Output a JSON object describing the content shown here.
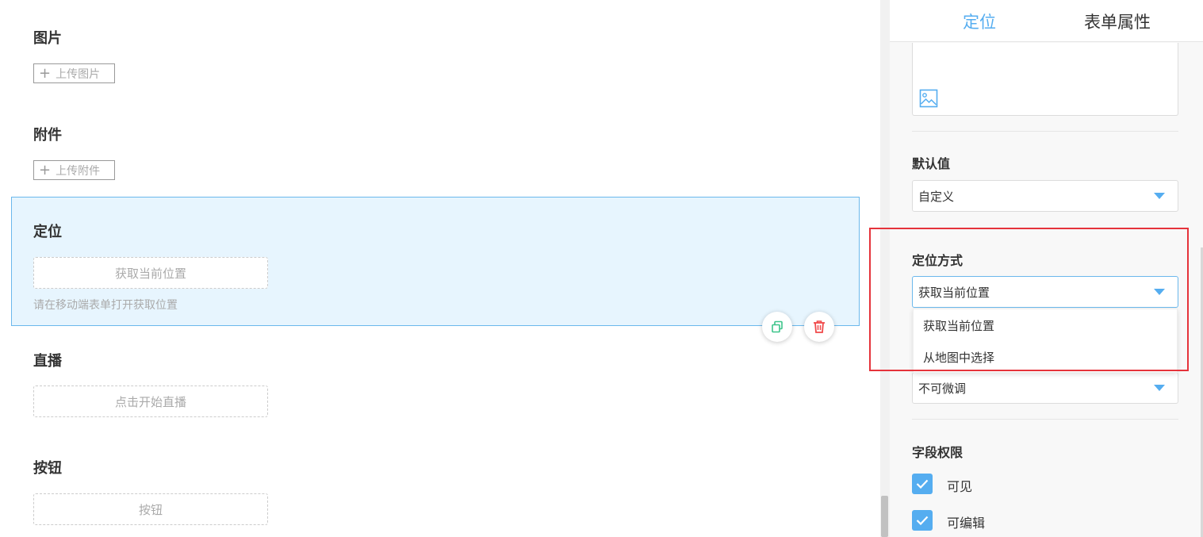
{
  "canvas": {
    "image_field": {
      "title": "图片",
      "upload_label": "上传图片"
    },
    "attachment_field": {
      "title": "附件",
      "upload_label": "上传附件"
    },
    "location_field": {
      "title": "定位",
      "button_label": "获取当前位置",
      "hint": "请在移动端表单打开获取位置"
    },
    "live_field": {
      "title": "直播",
      "button_label": "点击开始直播"
    },
    "button_field": {
      "title": "按钮",
      "button_label": "按钮"
    },
    "actions": {
      "copy_icon": "copy-icon",
      "delete_icon": "trash-icon"
    }
  },
  "panel": {
    "tabs": [
      {
        "label": "定位",
        "active": true
      },
      {
        "label": "表单属性",
        "active": false
      }
    ],
    "image_icon": "image-icon",
    "default_value": {
      "label": "默认值",
      "selected": "自定义"
    },
    "location_mode": {
      "label": "定位方式",
      "selected": "获取当前位置",
      "options": [
        "获取当前位置",
        "从地图中选择"
      ]
    },
    "adjust": {
      "selected": "不可微调"
    },
    "permissions": {
      "label": "字段权限",
      "items": [
        {
          "label": "可见",
          "checked": true
        },
        {
          "label": "可编辑",
          "checked": true
        }
      ]
    }
  },
  "colors": {
    "accent": "#55adf0",
    "selected_bg": "#e7f5fe",
    "highlight_frame": "#e5333b",
    "danger": "#f0494a",
    "copy_green": "#3cc48a"
  }
}
